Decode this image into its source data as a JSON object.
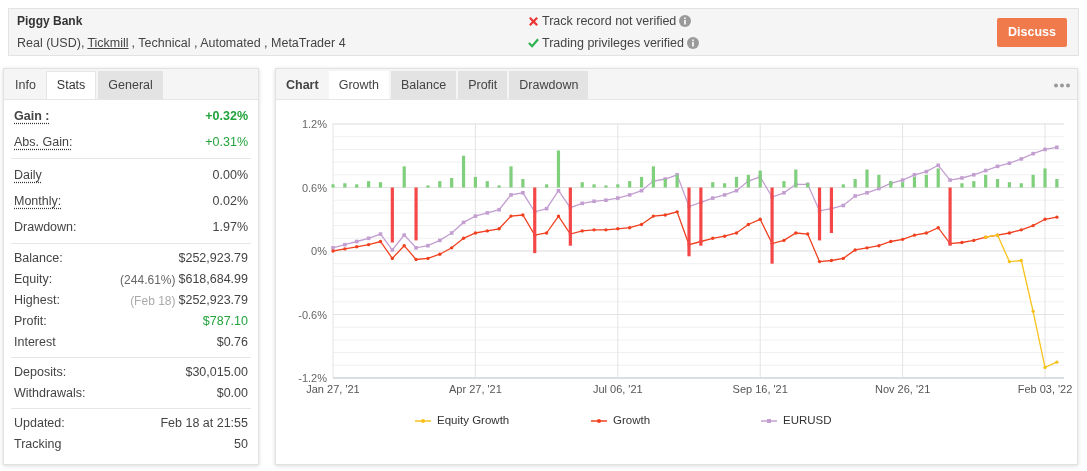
{
  "header": {
    "title": "Piggy Bank",
    "details": [
      {
        "text": "Real (USD),",
        "link": false
      },
      {
        "text": "Tickmill",
        "link": true
      },
      {
        "text": ", Technical , Automated , MetaTrader 4",
        "link": false
      }
    ],
    "verifications": [
      {
        "text": "Track record not verified",
        "verified": false
      },
      {
        "text": "Trading privileges verified",
        "verified": true
      }
    ],
    "button": "Discuss"
  },
  "stats_panel": {
    "tabs": [
      {
        "label": "Info",
        "selected": false
      },
      {
        "label": "Stats",
        "selected": true
      },
      {
        "label": "General",
        "selected": false
      }
    ],
    "groups": [
      {
        "rows": [
          {
            "label": "Gain :",
            "value": "+0.32%",
            "bold": true,
            "underlined": true,
            "positive": true
          },
          {
            "label": "Abs. Gain:",
            "value": "+0.31%",
            "bold": false,
            "underlined": true,
            "positive": true
          }
        ]
      },
      {
        "rows": [
          {
            "label": "Daily",
            "value": "0.00%",
            "bold": false,
            "underlined": true,
            "positive": false
          },
          {
            "label": "Monthly:",
            "value": "0.02%",
            "bold": false,
            "underlined": true,
            "positive": false
          },
          {
            "label": "Drawdown:",
            "value": "1.97%",
            "bold": false,
            "underlined": false,
            "positive": false
          }
        ]
      },
      {
        "rows": [
          {
            "label": "Balance:",
            "value": "$252,923.79",
            "bold": false,
            "underlined": false,
            "positive": false
          },
          {
            "label": "Equity:",
            "note": "(244.61%)",
            "note_faded": false,
            "value": "$618,684.99",
            "bold": false,
            "underlined": false,
            "positive": false
          },
          {
            "label": "Highest:",
            "note": "(Feb 18)",
            "note_faded": true,
            "value": "$252,923.79",
            "bold": false,
            "underlined": false,
            "positive": false
          },
          {
            "label": "Profit:",
            "value": "$787.10",
            "bold": false,
            "underlined": false,
            "positive": true
          },
          {
            "label": "Interest",
            "value": "$0.76",
            "bold": false,
            "underlined": false,
            "positive": false
          }
        ]
      },
      {
        "rows": [
          {
            "label": "Deposits:",
            "value": "$30,015.00",
            "bold": false,
            "underlined": false,
            "positive": false
          },
          {
            "label": "Withdrawals:",
            "value": "$0.00",
            "bold": false,
            "underlined": false,
            "positive": false
          }
        ]
      },
      {
        "rows": [
          {
            "label": "Updated:",
            "value": "Feb 18 at 21:55",
            "bold": false,
            "underlined": false,
            "positive": false
          },
          {
            "label": "Tracking",
            "value": "50",
            "bold": false,
            "underlined": false,
            "positive": false
          }
        ]
      }
    ]
  },
  "chart_panel": {
    "heading": "Chart",
    "tabs": [
      {
        "label": "Growth",
        "selected": true
      },
      {
        "label": "Balance",
        "selected": false
      },
      {
        "label": "Profit",
        "selected": false
      },
      {
        "label": "Drawdown",
        "selected": false
      }
    ],
    "chart_data": {
      "type": "line",
      "grid": true,
      "categories": [
        "Jan 27, '21",
        null,
        null,
        null,
        null,
        null,
        null,
        null,
        null,
        null,
        null,
        null,
        "Apr 27, '21",
        null,
        null,
        null,
        null,
        null,
        null,
        null,
        null,
        null,
        null,
        null,
        "Jul 06, '21",
        null,
        null,
        null,
        null,
        null,
        null,
        null,
        null,
        null,
        null,
        null,
        "Sep 16, '21",
        null,
        null,
        null,
        null,
        null,
        null,
        null,
        null,
        null,
        null,
        null,
        "Nov 26, '21",
        null,
        null,
        null,
        null,
        null,
        null,
        null,
        null,
        null,
        null,
        null,
        "Feb 03, '22",
        null
      ],
      "ylim": [
        -1.2,
        1.2
      ],
      "yticks": [
        {
          "value": 1.2,
          "label": "1.2%"
        },
        {
          "value": 0.6,
          "label": "0.6%"
        },
        {
          "value": 0,
          "label": "0%"
        },
        {
          "value": -0.6,
          "label": "-0.6%"
        },
        {
          "value": -1.2,
          "label": "-1.2%"
        }
      ],
      "series": [
        {
          "name": "Equity Growth",
          "color": "#f7c21b",
          "values": [
            null,
            null,
            null,
            null,
            null,
            null,
            null,
            null,
            null,
            null,
            null,
            null,
            null,
            null,
            null,
            null,
            null,
            null,
            null,
            null,
            null,
            null,
            null,
            null,
            null,
            null,
            null,
            null,
            null,
            null,
            null,
            null,
            null,
            null,
            null,
            null,
            null,
            null,
            null,
            null,
            null,
            null,
            null,
            null,
            null,
            null,
            null,
            null,
            null,
            null,
            null,
            null,
            null,
            null,
            null,
            0.13,
            0.15,
            -0.1,
            -0.09,
            -0.57,
            -1.1,
            -1.05
          ]
        },
        {
          "name": "Growth",
          "color": "#f0401f",
          "values": [
            0,
            0.02,
            0.04,
            0.06,
            0.09,
            -0.07,
            0.05,
            -0.08,
            -0.07,
            -0.03,
            0.03,
            0.12,
            0.17,
            0.19,
            0.21,
            0.33,
            0.34,
            0.15,
            0.17,
            0.33,
            0.16,
            0.19,
            0.2,
            0.2,
            0.21,
            0.22,
            0.25,
            0.33,
            0.34,
            0.37,
            0.06,
            0.09,
            0.12,
            0.14,
            0.17,
            0.25,
            0.3,
            0.07,
            0.1,
            0.17,
            0.16,
            -0.1,
            -0.09,
            -0.07,
            0.01,
            0.03,
            0.05,
            0.09,
            0.11,
            0.15,
            0.17,
            0.22,
            0.07,
            0.08,
            0.1,
            0.13,
            0.15,
            0.17,
            0.2,
            0.24,
            0.3,
            0.32
          ]
        },
        {
          "name": "EURUSD",
          "color": "#c39fd1",
          "marker": "square",
          "values": [
            0.03,
            0.06,
            0.09,
            0.12,
            0.16,
            0.01,
            0.15,
            0.03,
            0.05,
            0.1,
            0.17,
            0.27,
            0.33,
            0.36,
            0.39,
            0.53,
            0.55,
            0.37,
            0.4,
            0.57,
            0.41,
            0.45,
            0.47,
            0.48,
            0.5,
            0.53,
            0.57,
            0.66,
            0.68,
            0.72,
            0.42,
            0.46,
            0.5,
            0.53,
            0.57,
            0.66,
            0.7,
            0.51,
            0.55,
            0.63,
            0.63,
            0.38,
            0.4,
            0.43,
            0.52,
            0.55,
            0.59,
            0.64,
            0.67,
            0.72,
            0.75,
            0.81,
            0.67,
            0.69,
            0.72,
            0.76,
            0.8,
            0.83,
            0.87,
            0.92,
            0.96,
            0.98
          ]
        }
      ]
    },
    "overlay": {
      "kind": "bar_strip"
    }
  }
}
